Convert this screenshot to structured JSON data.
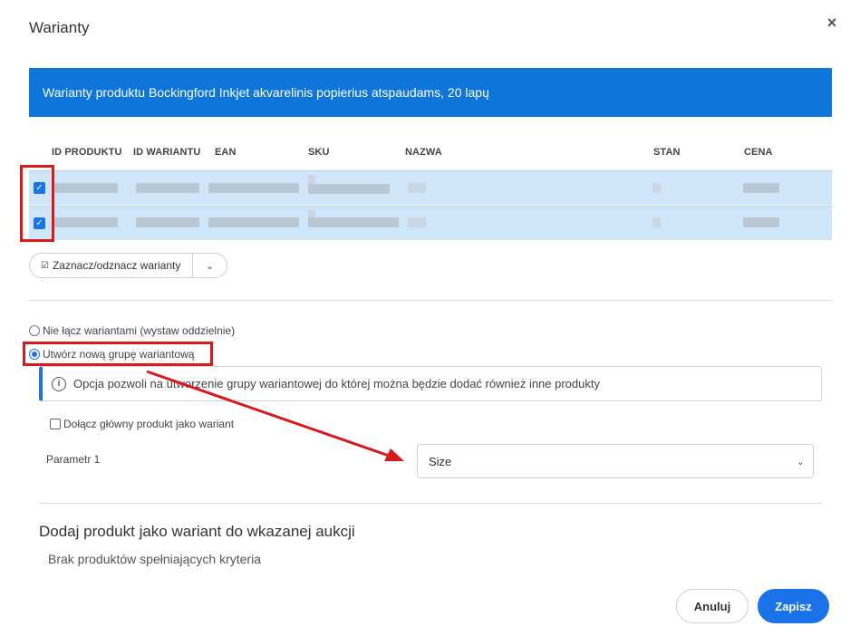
{
  "dialog": {
    "title": "Warianty",
    "close_glyph": "×"
  },
  "banner": {
    "text": "Warianty produktu Bockingford Inkjet akvarelinis popierius atspaudams, 20 lapų"
  },
  "table": {
    "headers": [
      "ID PRODUKTU",
      "ID WARIANTU",
      "EAN",
      "SKU",
      "NAZWA",
      "STAN",
      "CENA"
    ],
    "rows": [
      {
        "checked": true,
        "check_glyph": "✓"
      },
      {
        "checked": true,
        "check_glyph": "✓"
      }
    ]
  },
  "toggle_variants": {
    "label": "Zaznacz/odznacz warianty",
    "icon": "checkbox-icon",
    "icon_glyph": "☑",
    "caret_glyph": "⌄"
  },
  "options": {
    "no_merge": {
      "label": "Nie łącz wariantami (wystaw oddzielnie)",
      "selected": false
    },
    "new_group": {
      "label": "Utwórz nową grupę wariantową",
      "selected": true
    }
  },
  "info": {
    "icon_glyph": "i",
    "text": "Opcja pozwoli na utworzenie grupy wariantowej do której można będzie dodać również inne produkty"
  },
  "include_main": {
    "label": "Dołącz główny produkt jako wariant",
    "checked": false
  },
  "parameter": {
    "label": "Parametr 1",
    "value": "Size",
    "chevron_glyph": "⌄"
  },
  "section": {
    "title": "Dodaj produkt jako wariant do wkazanej aukcji",
    "empty": "Brak produktów spełniających kryteria"
  },
  "footer": {
    "cancel": "Anuluj",
    "save": "Zapisz"
  },
  "colors": {
    "accent": "#1a73e8",
    "banner": "#0f76d9",
    "selected_row": "#cfe5fa",
    "annotation": "#d91a1a"
  }
}
